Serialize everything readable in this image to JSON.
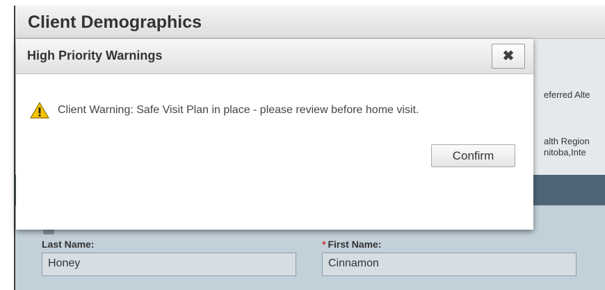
{
  "app": {
    "title": "Client Demographics",
    "partial_info": [
      "eferred Alte",
      "alth Region",
      "nitoba,Inte"
    ]
  },
  "form": {
    "last_name_label": "Last Name:",
    "last_name_value": "Honey",
    "first_name_required_mark": "*",
    "first_name_label": "First Name:",
    "first_name_value": "Cinnamon"
  },
  "dialog": {
    "title": "High Priority Warnings",
    "close_icon": "close-icon",
    "close_glyph": "✖",
    "warning_icon": "warning-icon",
    "warning_text": "Client Warning: Safe Visit Plan in place - please review before home visit.",
    "confirm_label": "Confirm"
  },
  "colors": {
    "warning_yellow": "#f5c400",
    "section_bar": "#4f6577",
    "form_background": "#c2d0d9"
  }
}
